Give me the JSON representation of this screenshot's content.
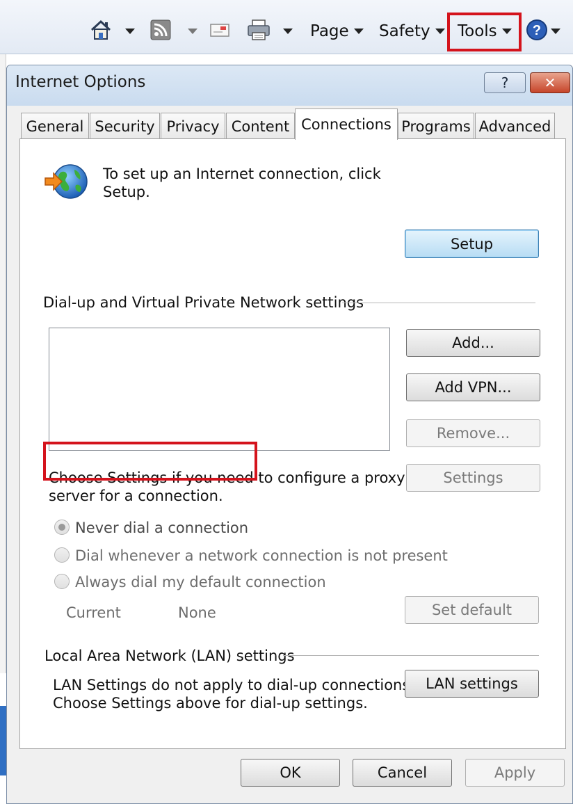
{
  "toolbar": {
    "home_icon": "home-icon",
    "feeds_icon": "rss-feed-icon",
    "mail_icon": "read-mail-icon",
    "print_icon": "print-icon",
    "page_label": "Page",
    "safety_label": "Safety",
    "tools_label": "Tools",
    "help_icon": "help-icon",
    "highlight_color": "#d4131c"
  },
  "dialog": {
    "title": "Internet Options",
    "help_button": "?",
    "close_button": "✕",
    "tabs": [
      "General",
      "Security",
      "Privacy",
      "Content",
      "Connections",
      "Programs",
      "Advanced"
    ],
    "active_tab": "Connections"
  },
  "connections": {
    "setup_text_line1": "To set up an Internet connection, click",
    "setup_text_line2": "Setup.",
    "setup_button": "Setup",
    "dialup_heading": "Dial-up and Virtual Private Network settings",
    "add_button": "Add...",
    "add_vpn_button": "Add VPN...",
    "remove_button": "Remove...",
    "settings_button": "Settings",
    "proxy_text_line1": "Choose Settings if you need to configure a proxy",
    "proxy_text_line2": "server for a connection.",
    "radio_options": [
      "Never dial a connection",
      "Dial whenever a network connection is not present",
      "Always dial my default connection"
    ],
    "selected_radio": "Never dial a connection",
    "current_label": "Current",
    "current_value": "None",
    "set_default_button": "Set default",
    "lan_heading": "Local Area Network (LAN) settings",
    "lan_text_line1": "LAN Settings do not apply to dial-up connections.",
    "lan_text_line2": "Choose Settings above for dial-up settings.",
    "lan_settings_button": "LAN settings"
  },
  "footer": {
    "ok_button": "OK",
    "cancel_button": "Cancel",
    "apply_button": "Apply"
  }
}
